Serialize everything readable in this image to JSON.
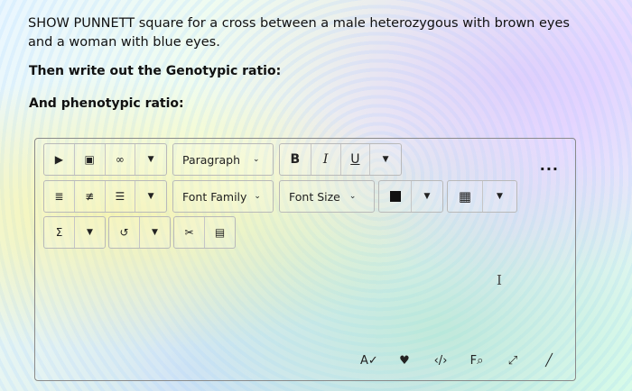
{
  "question": {
    "line1": "SHOW PUNNETT square for a cross between a male heterozygous with brown eyes",
    "line2": "and a woman with blue eyes.",
    "sub1": "Then write out the Genotypic ratio:",
    "sub2": "And phenotypic ratio:"
  },
  "toolbar": {
    "paragraph_label": "Paragraph",
    "bold_label": "B",
    "italic_label": "I",
    "underline_label": "U",
    "font_family_label": "Font Familу",
    "font_size_label": "Font Size",
    "more_label": "..."
  },
  "icons": {
    "insert_stuff": "▶",
    "camera": "▣",
    "link": "∞",
    "align": "≣",
    "indent": "≢",
    "list": "☰",
    "table": "▦",
    "sigma": "Σ",
    "undo": "↺",
    "cut": "✂",
    "paste": "▤",
    "spellcheck": "A✓",
    "accessibility": "♥",
    "source": "‹/›",
    "find": "F⌕",
    "fullscreen": "⤢",
    "resize": "╱"
  },
  "colors": {
    "border": "#8a8a8a",
    "text": "#111111"
  }
}
